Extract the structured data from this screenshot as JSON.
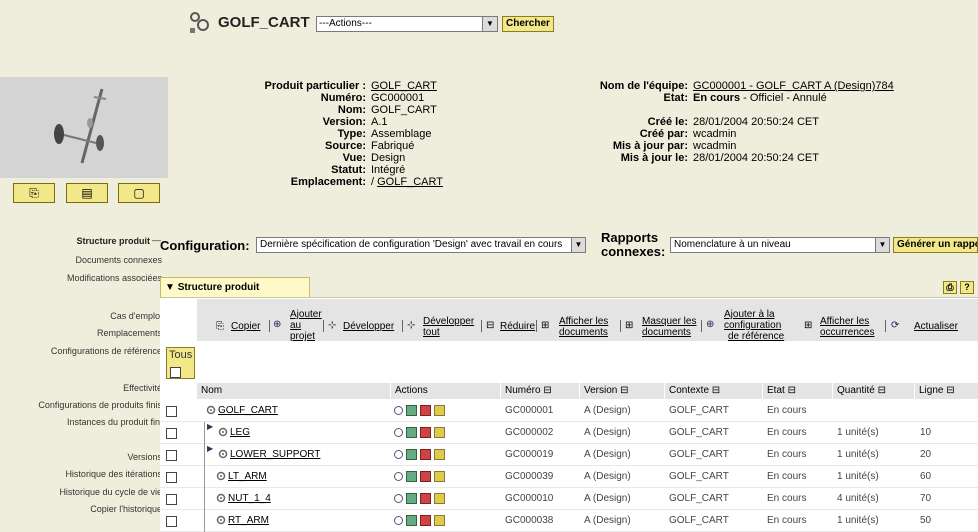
{
  "header": {
    "title": "GOLF_CART",
    "actions_placeholder": "---Actions---",
    "search_label": "Chercher"
  },
  "thumbnail_buttons": [
    "clipboard-icon",
    "view-icon",
    "folder-icon"
  ],
  "details_left": [
    {
      "label": "Produit particulier :",
      "value": "GOLF_CART",
      "link": true
    },
    {
      "label": "Numéro:",
      "value": "GC000001",
      "link": false
    },
    {
      "label": "Nom:",
      "value": "GOLF_CART",
      "link": false
    },
    {
      "label": "Version:",
      "value": "A.1",
      "link": false
    },
    {
      "label": "Type:",
      "value": "Assemblage",
      "link": false
    },
    {
      "label": "Source:",
      "value": "Fabriqué",
      "link": false
    },
    {
      "label": "Vue:",
      "value": "Design",
      "link": false
    },
    {
      "label": "Statut:",
      "value": "Intégré",
      "link": false
    },
    {
      "label": "Emplacement:",
      "value_prefix": "/ ",
      "value": "GOLF_CART",
      "link": true
    }
  ],
  "details_right": {
    "team_label": "Nom de l'équipe:",
    "team_value": "GC000001 - GOLF_CART A (Design)784",
    "state_label": "Etat:",
    "state_bold": "En cours",
    "state_rest": " - Officiel - Annulé",
    "created_label": "Créé le:",
    "created_value": "28/01/2004 20:50:24 CET",
    "created_by_label": "Créé par:",
    "created_by_value": "wcadmin",
    "updated_by_label": "Mis à jour par:",
    "updated_by_value": "wcadmin",
    "updated_label": "Mis à jour le:",
    "updated_value": "28/01/2004 20:50:24 CET"
  },
  "nav": {
    "active": "Structure produit",
    "active_marker": "—",
    "items": [
      "Documents connexes",
      "Modifications associées",
      "Cas d'emploi",
      "Remplacements",
      "Configurations de référence",
      "Effectivité",
      "Configurations de produits finis",
      "Instances du produit fini",
      "Versions",
      "Historique des itérations",
      "Historique du cycle de vie",
      "Copier l'historique"
    ]
  },
  "configuration": {
    "label": "Configuration:",
    "value": "Dernière spécification de configuration 'Design' avec travail en cours",
    "reports_label_1": "Rapports",
    "reports_label_2": "connexes:",
    "reports_value": "Nomenclature à un niveau",
    "generate_label": "Générer un rappor"
  },
  "structure": {
    "tab_label": "Structure produit",
    "tab_marker": "▼",
    "select_all_label": "Tous",
    "toolbar": {
      "copy": "Copier",
      "add_1": "Ajouter",
      "add_2": "au",
      "add_3": "projet",
      "expand": "Développer",
      "expand_all_1": "Développer",
      "expand_all_2": "tout",
      "collapse": "Réduire",
      "show_docs_1": "Afficher les",
      "show_docs_2": "documents",
      "hide_docs_1": "Masquer les",
      "hide_docs_2": "documents",
      "add_ref_1": "Ajouter à la",
      "add_ref_2": "configuration",
      "add_ref_3": "de référence",
      "show_occ_1": "Afficher les",
      "show_occ_2": "occurrences",
      "refresh": "Actualiser"
    },
    "columns": [
      "Nom",
      "Actions",
      "Numéro ⊟",
      "Version ⊟",
      "Contexte ⊟",
      "Etat ⊟",
      "Quantité ⊟",
      "Ligne ⊟"
    ],
    "rows": [
      {
        "name": "GOLF_CART",
        "number": "GC000001",
        "version": "A (Design)",
        "context": "GOLF_CART",
        "state": "En cours",
        "qty": "",
        "line": ""
      },
      {
        "name": "LEG",
        "number": "GC000002",
        "version": "A (Design)",
        "context": "GOLF_CART",
        "state": "En cours",
        "qty": "1 unité(s)",
        "line": "10"
      },
      {
        "name": "LOWER_SUPPORT",
        "number": "GC000019",
        "version": "A (Design)",
        "context": "GOLF_CART",
        "state": "En cours",
        "qty": "1 unité(s)",
        "line": "20"
      },
      {
        "name": "LT_ARM",
        "number": "GC000039",
        "version": "A (Design)",
        "context": "GOLF_CART",
        "state": "En cours",
        "qty": "1 unité(s)",
        "line": "60"
      },
      {
        "name": "NUT_1_4",
        "number": "GC000010",
        "version": "A (Design)",
        "context": "GOLF_CART",
        "state": "En cours",
        "qty": "4 unité(s)",
        "line": "70"
      },
      {
        "name": "RT_ARM",
        "number": "GC000038",
        "version": "A (Design)",
        "context": "GOLF_CART",
        "state": "En cours",
        "qty": "1 unité(s)",
        "line": "50"
      }
    ]
  }
}
